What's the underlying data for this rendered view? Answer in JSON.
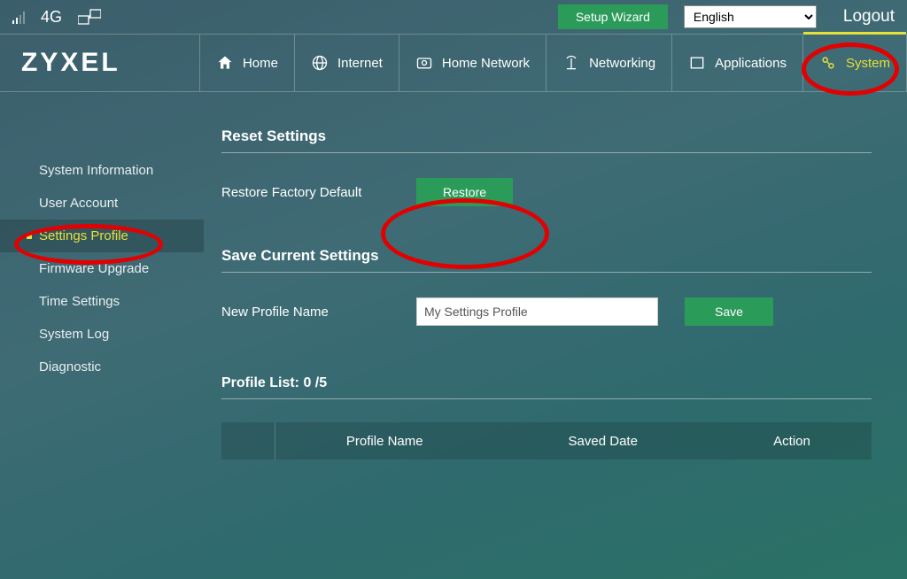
{
  "status": {
    "network_type": "4G"
  },
  "header": {
    "setup_wizard": "Setup Wizard",
    "language": "English",
    "logout": "Logout",
    "brand": "ZYXEL"
  },
  "nav": {
    "items": [
      {
        "label": "Home"
      },
      {
        "label": "Internet"
      },
      {
        "label": "Home Network"
      },
      {
        "label": "Networking"
      },
      {
        "label": "Applications"
      },
      {
        "label": "System",
        "active": true
      }
    ]
  },
  "sidebar": {
    "items": [
      {
        "label": "System Information"
      },
      {
        "label": "User Account"
      },
      {
        "label": "Settings Profile",
        "active": true
      },
      {
        "label": "Firmware Upgrade"
      },
      {
        "label": "Time Settings"
      },
      {
        "label": "System Log"
      },
      {
        "label": "Diagnostic"
      }
    ]
  },
  "main": {
    "reset_title": "Reset Settings",
    "restore_label": "Restore Factory Default",
    "restore_button": "Restore",
    "save_title": "Save Current Settings",
    "profile_name_label": "New Profile Name",
    "profile_name_value": "My Settings Profile",
    "save_button": "Save",
    "profile_list_title": "Profile List: 0 /5",
    "table": {
      "col_profile": "Profile Name",
      "col_date": "Saved Date",
      "col_action": "Action"
    }
  }
}
